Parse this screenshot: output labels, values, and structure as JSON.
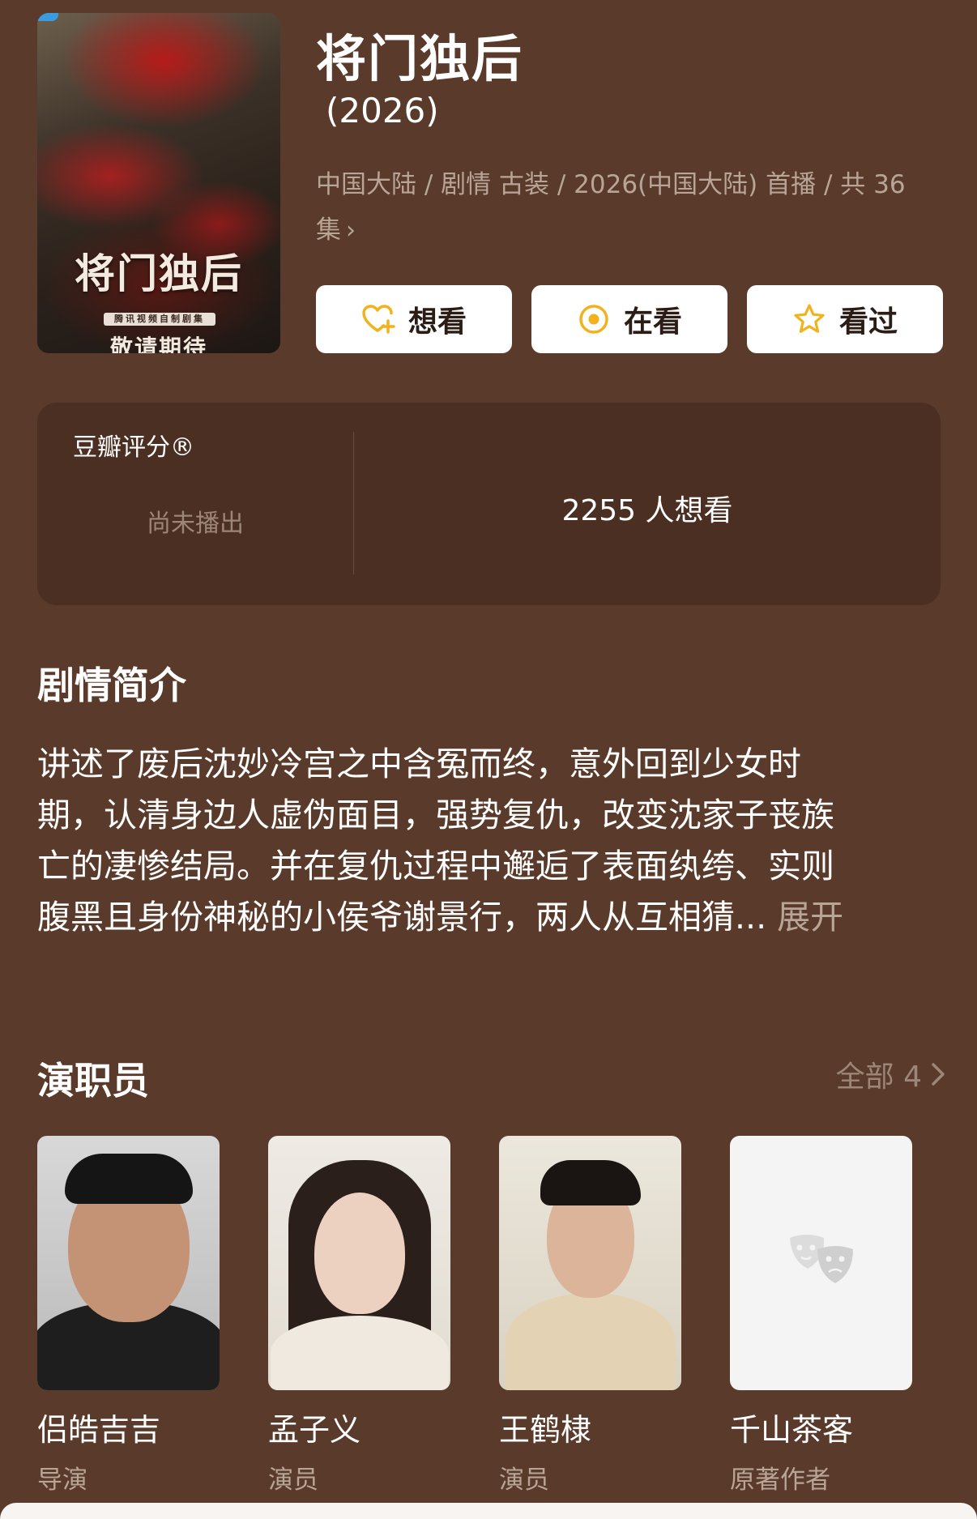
{
  "poster": {
    "title": "将门独后",
    "sub": "腾讯视频自制剧集",
    "tagline": "敬请期待"
  },
  "title": "将门独后",
  "year": "(2026)",
  "meta": {
    "text": "中国大陆 / 剧情 古装 / 2026(中国大陆) 首播 / 共 36 集"
  },
  "actions": [
    {
      "label": "想看",
      "icon": "heart-plus-icon"
    },
    {
      "label": "在看",
      "icon": "target-icon"
    },
    {
      "label": "看过",
      "icon": "star-icon"
    }
  ],
  "rating": {
    "label": "豆瓣评分®",
    "status": "尚未播出",
    "want": "2255 人想看"
  },
  "synopsis": {
    "title": "剧情简介",
    "lines": [
      "讲述了废后沈妙冷宫之中含冤而终，意外回到少女时",
      "期，认清身边人虚伪面目，强势复仇，改变沈家子丧族",
      "亡的凄惨结局。并在复仇过程中邂逅了表面纨绔、实则",
      "腹黑且身份神秘的小侯爷谢景行，两人从互相猜..."
    ],
    "expand": "展开"
  },
  "cast": {
    "title": "演职员",
    "all_label": "全部 4",
    "members": [
      {
        "name": "侣皓吉吉",
        "role": "导演"
      },
      {
        "name": "孟子义",
        "role": "演员"
      },
      {
        "name": "王鹤棣",
        "role": "演员"
      },
      {
        "name": "千山茶客",
        "role": "原著作者"
      }
    ]
  },
  "colors": {
    "background": "#5a3a2a",
    "card": "#4a2f22",
    "accent": "#f2b21b"
  }
}
